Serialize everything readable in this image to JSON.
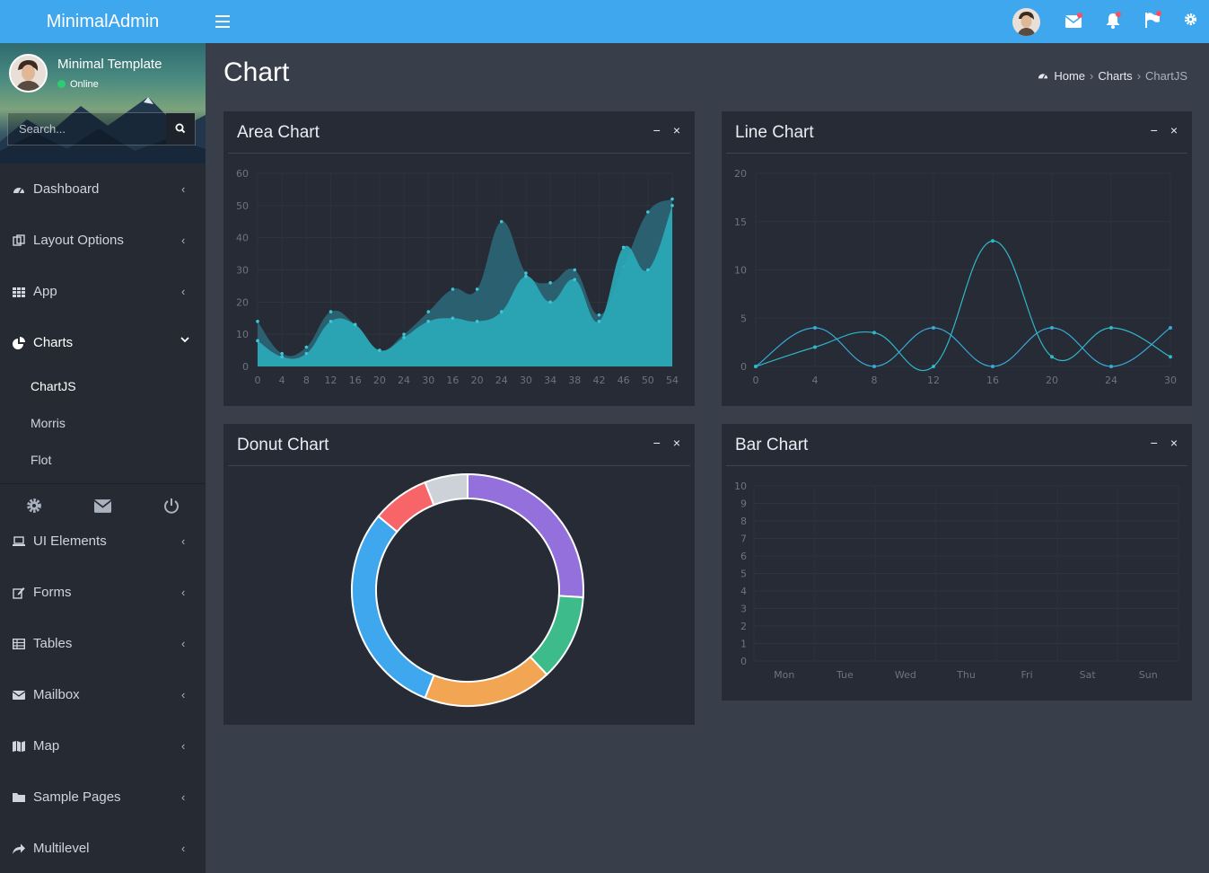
{
  "header": {
    "brand": "MinimalAdmin",
    "notification_dot_color": "#ff4d5e",
    "icons": [
      "menu-icon",
      "avatar",
      "mail-icon",
      "bell-icon",
      "flag-icon",
      "gear-icon"
    ]
  },
  "sidebar": {
    "user": {
      "name": "Minimal Template",
      "status": "Online"
    },
    "search": {
      "placeholder": "Search..."
    },
    "items": [
      {
        "label": "Dashboard",
        "icon": "dashboard-icon"
      },
      {
        "label": "Layout Options",
        "icon": "layout-icon"
      },
      {
        "label": "App",
        "icon": "grid-icon"
      },
      {
        "label": "Charts",
        "icon": "pie-chart-icon",
        "expanded": true,
        "children": [
          {
            "label": "ChartJS",
            "active": true
          },
          {
            "label": "Morris"
          },
          {
            "label": "Flot"
          }
        ]
      },
      {
        "label": "UI Elements",
        "icon": "laptop-icon"
      },
      {
        "label": "Forms",
        "icon": "edit-icon"
      },
      {
        "label": "Tables",
        "icon": "table-icon"
      },
      {
        "label": "Mailbox",
        "icon": "envelope-icon"
      },
      {
        "label": "Map",
        "icon": "map-icon"
      },
      {
        "label": "Sample Pages",
        "icon": "folder-icon"
      },
      {
        "label": "Multilevel",
        "icon": "share-icon"
      }
    ],
    "tools": [
      "gear-icon",
      "envelope-icon",
      "power-icon"
    ]
  },
  "page": {
    "title": "Chart",
    "breadcrumb": [
      "Home",
      "Charts",
      "ChartJS"
    ]
  },
  "cards": {
    "area": {
      "title": "Area Chart"
    },
    "line": {
      "title": "Line Chart"
    },
    "donut": {
      "title": "Donut Chart"
    },
    "bar": {
      "title": "Bar Chart"
    },
    "tools": {
      "minimize": "−",
      "close": "×"
    }
  },
  "chart_data": [
    {
      "type": "area",
      "title": "Area Chart",
      "x": [
        "0",
        "4",
        "8",
        "12",
        "16",
        "20",
        "24",
        "30",
        "16",
        "20",
        "24",
        "30",
        "34",
        "38",
        "42",
        "46",
        "50",
        "54"
      ],
      "ylim": [
        0,
        60
      ],
      "yticks": [
        0,
        10,
        20,
        30,
        40,
        50,
        60
      ],
      "series": [
        {
          "color": "#2aa9b8",
          "values": [
            8,
            3,
            4,
            14,
            13,
            5,
            9,
            14,
            15,
            14,
            17,
            28,
            20,
            27,
            14,
            37,
            30,
            50
          ]
        },
        {
          "color": "#2a6373",
          "values": [
            14,
            4,
            6,
            17,
            13,
            5,
            10,
            17,
            24,
            24,
            45,
            29,
            26,
            30,
            16,
            31,
            48,
            52
          ]
        }
      ]
    },
    {
      "type": "line",
      "title": "Line Chart",
      "x": [
        "0",
        "4",
        "8",
        "12",
        "16",
        "20",
        "24",
        "30"
      ],
      "ylim": [
        0,
        20
      ],
      "yticks": [
        0,
        5,
        10,
        15,
        20
      ],
      "series": [
        {
          "color": "#38a9d8",
          "values": [
            0,
            4,
            0,
            4,
            0,
            4,
            0,
            4
          ]
        },
        {
          "color": "#2fb7c8",
          "values": [
            0,
            2,
            3.5,
            0,
            13,
            1,
            4,
            1
          ]
        }
      ]
    },
    {
      "type": "pie",
      "title": "Donut Chart",
      "slices": [
        {
          "value": 26,
          "color": "#9370db"
        },
        {
          "value": 12,
          "color": "#3dbb8b"
        },
        {
          "value": 18,
          "color": "#f2a654"
        },
        {
          "value": 30,
          "color": "#3fa7ee"
        },
        {
          "value": 8,
          "color": "#f76569"
        },
        {
          "value": 6,
          "color": "#cdd2d9"
        }
      ]
    },
    {
      "type": "bar",
      "title": "Bar Chart",
      "categories": [
        "Mon",
        "Tue",
        "Wed",
        "Thu",
        "Fri",
        "Sat",
        "Sun"
      ],
      "ylim": [
        0,
        10
      ],
      "yticks": [
        0,
        1,
        2,
        3,
        4,
        5,
        6,
        7,
        8,
        9,
        10
      ],
      "values": []
    }
  ]
}
